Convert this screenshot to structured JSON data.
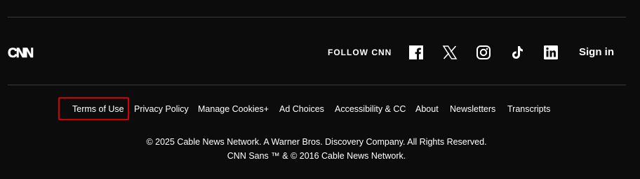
{
  "brand": {
    "logo_text": "CNN"
  },
  "social": {
    "follow_label": "FOLLOW CNN",
    "icons": [
      "facebook-icon",
      "x-icon",
      "instagram-icon",
      "tiktok-icon",
      "linkedin-icon"
    ]
  },
  "account": {
    "sign_in_label": "Sign in"
  },
  "footer_links": [
    "Terms of Use",
    "Privacy Policy",
    "Manage Cookies+",
    "Ad Choices",
    "Accessibility & CC",
    "About",
    "Newsletters",
    "Transcripts"
  ],
  "legal": {
    "copyright": "© 2025 Cable News Network. A Warner Bros. Discovery Company. All Rights Reserved.",
    "font_notice": "CNN Sans ™ & © 2016 Cable News Network."
  },
  "colors": {
    "background": "#0c0c0c",
    "text": "#ffffff",
    "divider": "#3a3a3a",
    "highlight": "#d40000"
  }
}
